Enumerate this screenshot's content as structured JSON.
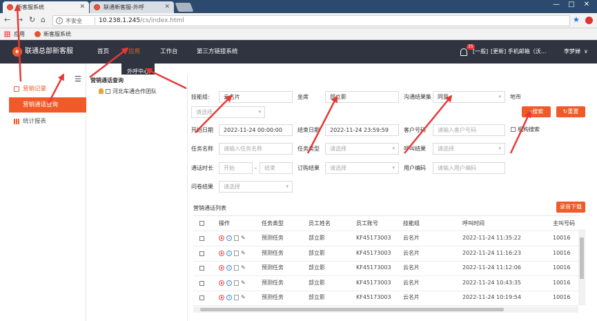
{
  "browser": {
    "tabs": [
      {
        "title": "新客服系统",
        "active": true
      },
      {
        "title": "联通新客服-外呼",
        "active": false
      }
    ],
    "insecure_label": "不安全",
    "url_host": "10.238.1.245",
    "url_path": "/cs/index.html",
    "bookmarks": {
      "apps_label": "应用",
      "item": "新客服系统"
    },
    "controls": {
      "minimize": "—",
      "maximize": "□",
      "close": "✕"
    }
  },
  "header": {
    "logo_glyph": "e",
    "brand": "联通总部新客服",
    "nav": [
      {
        "label": "首页"
      },
      {
        "label": "应用"
      },
      {
        "label": "工作台"
      },
      {
        "label": "第三方链接系统"
      }
    ],
    "badge_count": "35",
    "level": "[一般]",
    "notice": "[更新] 手机邮箱（沃...",
    "user": "李梦婵",
    "user_caret": "∨"
  },
  "dropdown": {
    "item": "外呼中心"
  },
  "sidebar": {
    "items": [
      {
        "label": "营销记录"
      },
      {
        "label": "营销通话查询"
      },
      {
        "label": "统计报表"
      }
    ]
  },
  "tree": {
    "title": "营销通话查询",
    "node": "河北车通合作团队"
  },
  "form": {
    "skill_group_label": "技能组:",
    "skill_group_value": "云名片",
    "seat_label": "坐席",
    "seat_value": "部立影",
    "result_set_label": "沟通结果集",
    "result_set_value": "同意",
    "city_label": "地市",
    "city_placeholder": "请选择",
    "start_date_label": "开始日期",
    "start_date_value": "2022-11-24 00:00:00",
    "end_date_label": "结束日期",
    "end_date_value": "2022-11-24 23:59:59",
    "customer_label": "客户号码",
    "customer_placeholder": "请输入客户号码",
    "org_search_label": "机构搜索",
    "task_name_label": "任务名称",
    "task_name_placeholder": "请输入任务名称",
    "task_type_label": "任务类型",
    "task_type_placeholder": "请选择",
    "call_result_label": "呼叫结果",
    "call_result_placeholder": "请选择",
    "duration_label": "通话时长",
    "duration_start_placeholder": "开始",
    "duration_sep": "-",
    "duration_end_placeholder": "结束",
    "order_result_label": "订购结果",
    "order_result_placeholder": "请选择",
    "user_code_label": "用户编码",
    "user_code_placeholder": "请输入用户编码",
    "survey_result_label": "问卷结果",
    "survey_result_placeholder": "请选择",
    "search_button": "搜索",
    "reset_button": "重置"
  },
  "list": {
    "title": "营销通话列表",
    "download_button": "录音下载",
    "columns": [
      "操作",
      "任务类型",
      "员工姓名",
      "员工账号",
      "技能组",
      "呼叫时间",
      "主叫号码"
    ],
    "rows": [
      {
        "task_type": "预测任务",
        "name": "部立影",
        "account": "KF45173003",
        "group": "云名片",
        "time": "2022-11-24 11:35:22",
        "caller": "10016"
      },
      {
        "task_type": "预测任务",
        "name": "部立影",
        "account": "KF45173003",
        "group": "云名片",
        "time": "2022-11-24 11:16:23",
        "caller": "10016"
      },
      {
        "task_type": "预测任务",
        "name": "部立影",
        "account": "KF45173003",
        "group": "云名片",
        "time": "2022-11-24 11:12:06",
        "caller": "10016"
      },
      {
        "task_type": "预测任务",
        "name": "部立影",
        "account": "KF45173003",
        "group": "云名片",
        "time": "2022-11-24 10:43:35",
        "caller": "10016"
      },
      {
        "task_type": "预测任务",
        "name": "部立影",
        "account": "KF45173003",
        "group": "云名片",
        "time": "2022-11-24 10:19:54",
        "caller": "10016"
      }
    ]
  },
  "colors": {
    "accent": "#f05a28",
    "header_bg": "#303440",
    "annotation": "#e53935"
  }
}
